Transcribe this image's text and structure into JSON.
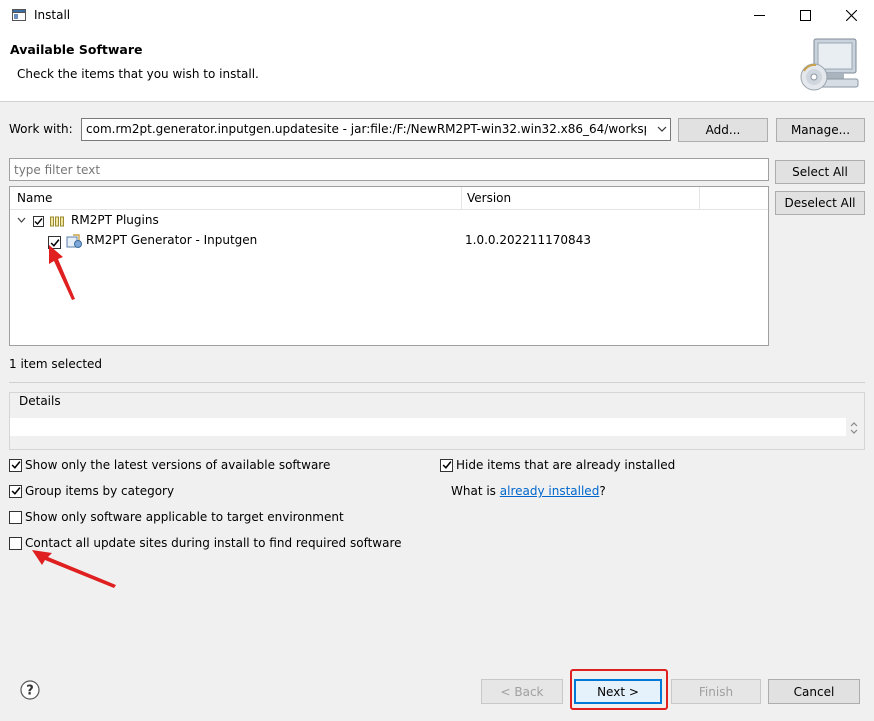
{
  "window": {
    "title": "Install",
    "controls": {
      "minimize_icon": "minimize-icon",
      "maximize_icon": "maximize-icon",
      "close_icon": "close-icon"
    }
  },
  "header": {
    "title": "Available Software",
    "subtitle": "Check the items that you wish to install."
  },
  "work_with": {
    "label": "Work with:",
    "value": "com.rm2pt.generator.inputgen.updatesite - jar:file:/F:/NewRM2PT-win32.win32.x86_64/workspace/",
    "add_label": "Add...",
    "manage_label": "Manage..."
  },
  "filter": {
    "placeholder": "type filter text"
  },
  "side_buttons": {
    "select_all": "Select All",
    "deselect_all": "Deselect All"
  },
  "tree": {
    "columns": [
      "Name",
      "Version"
    ],
    "category": {
      "name": "RM2PT Plugins",
      "checked": true,
      "expanded": true
    },
    "items": [
      {
        "name": "RM2PT Generator - Inputgen",
        "version": "1.0.0.202211170843",
        "checked": true
      }
    ]
  },
  "status": "1 item selected",
  "details": {
    "label": "Details",
    "text": ""
  },
  "options": {
    "latest_versions": {
      "label": "Show only the latest versions of available software",
      "checked": true
    },
    "group_by_category": {
      "label": "Group items by category",
      "checked": true
    },
    "target_environment": {
      "label": "Show only software applicable to target environment",
      "checked": false
    },
    "contact_sites": {
      "label": "Contact all update sites during install to find required software",
      "checked": false
    },
    "hide_installed": {
      "label": "Hide items that are already installed",
      "checked": true
    },
    "what_is": "What is",
    "already_installed_link": "already installed",
    "what_is_suffix": "?"
  },
  "footer": {
    "back": "< Back",
    "next": "Next >",
    "finish": "Finish",
    "cancel": "Cancel"
  },
  "colors": {
    "annotation_red": "#e02020",
    "link": "#0066cc"
  }
}
